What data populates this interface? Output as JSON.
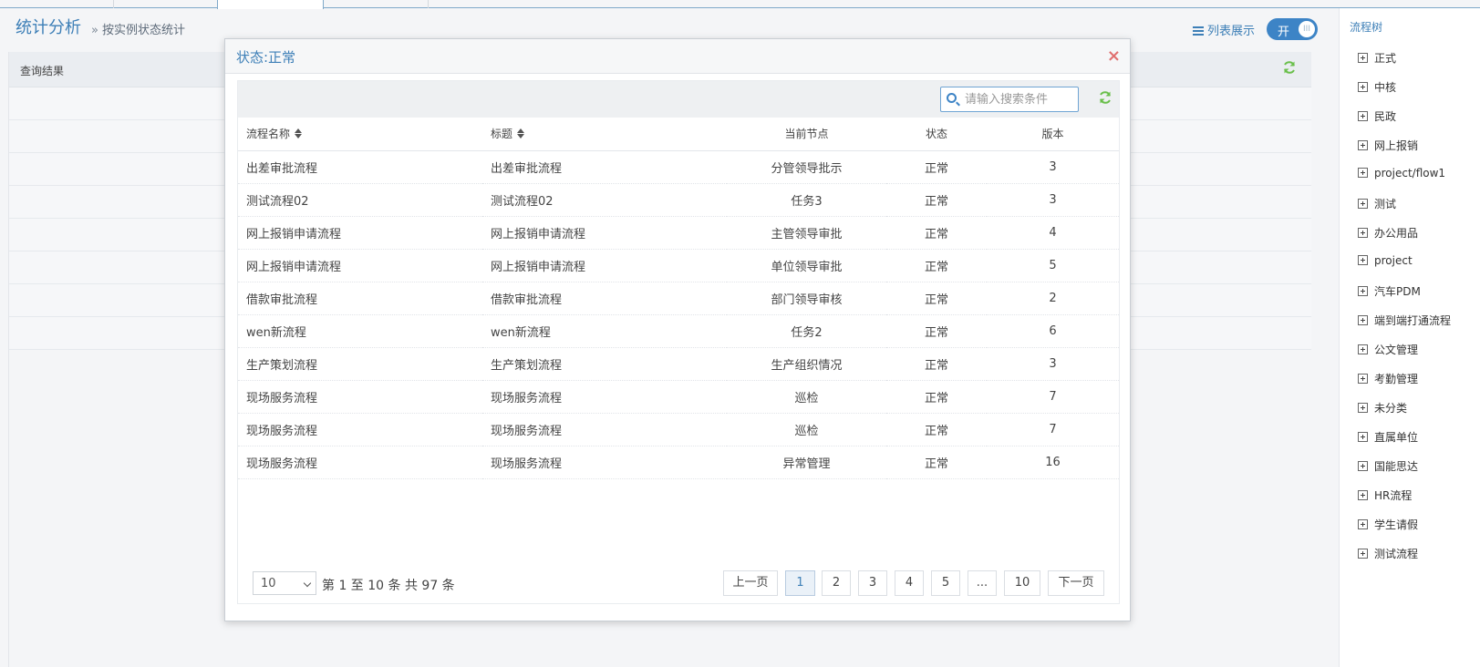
{
  "header": {
    "title": "统计分析",
    "breadcrumb_sep": "»",
    "breadcrumb": "按实例状态统计",
    "view_link": "列表展示",
    "switch_label": "开",
    "switch_knob": "III"
  },
  "results_panel": {
    "label": "查询结果"
  },
  "sidebar": {
    "title": "流程树",
    "items": [
      "正式",
      "中核",
      "民政",
      "网上报销",
      "project/flow1",
      "测试",
      "办公用品",
      "project",
      "汽车PDM",
      "端到端打通流程",
      "公文管理",
      "考勤管理",
      "未分类",
      "直属单位",
      "国能思达",
      "HR流程",
      "学生请假",
      "测试流程"
    ]
  },
  "modal": {
    "title": "状态:正常",
    "close": "×",
    "search_placeholder": "请输入搜索条件",
    "columns": [
      "流程名称",
      "标题",
      "当前节点",
      "状态",
      "版本"
    ],
    "rows": [
      [
        "出差审批流程",
        "出差审批流程",
        "分管领导批示",
        "正常",
        "3"
      ],
      [
        "测试流程02",
        "测试流程02",
        "任务3",
        "正常",
        "3"
      ],
      [
        "网上报销申请流程",
        "网上报销申请流程",
        "主管领导审批",
        "正常",
        "4"
      ],
      [
        "网上报销申请流程",
        "网上报销申请流程",
        "单位领导审批",
        "正常",
        "5"
      ],
      [
        "借款审批流程",
        "借款审批流程",
        "部门领导审核",
        "正常",
        "2"
      ],
      [
        "wen新流程",
        "wen新流程",
        "任务2",
        "正常",
        "6"
      ],
      [
        "生产策划流程",
        "生产策划流程",
        "生产组织情况",
        "正常",
        "3"
      ],
      [
        "现场服务流程",
        "现场服务流程",
        "巡检",
        "正常",
        "7"
      ],
      [
        "现场服务流程",
        "现场服务流程",
        "巡检",
        "正常",
        "7"
      ],
      [
        "现场服务流程",
        "现场服务流程",
        "异常管理",
        "正常",
        "16"
      ]
    ],
    "page_size": "10",
    "page_info": "第 1 至 10 条 共 97 条",
    "pagination": {
      "prev": "上一页",
      "pages": [
        "1",
        "2",
        "3",
        "4",
        "5",
        "...",
        "10"
      ],
      "current": "1",
      "next": "下一页"
    }
  },
  "colors": {
    "accent": "#3d7fb7",
    "refresh": "#6abf4b",
    "close": "#e06f6f"
  }
}
